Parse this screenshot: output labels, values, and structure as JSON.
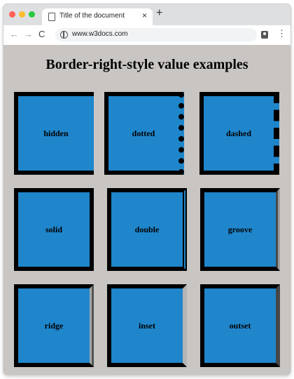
{
  "browser": {
    "tab_title": "Title of the document",
    "tab_close": "×",
    "new_tab": "+",
    "url": "www.w3docs.com",
    "back": "←",
    "forward": "→",
    "reload": "C",
    "menu": "⋮"
  },
  "page": {
    "heading": "Border-right-style value examples",
    "boxes": [
      {
        "label": "hidden"
      },
      {
        "label": "dotted"
      },
      {
        "label": "dashed"
      },
      {
        "label": "solid"
      },
      {
        "label": "double"
      },
      {
        "label": "groove"
      },
      {
        "label": "ridge"
      },
      {
        "label": "inset"
      },
      {
        "label": "outset"
      }
    ]
  },
  "colors": {
    "page_background": "#c9c5c2",
    "box_fill": "#1f86cc",
    "box_border": "#000000"
  }
}
